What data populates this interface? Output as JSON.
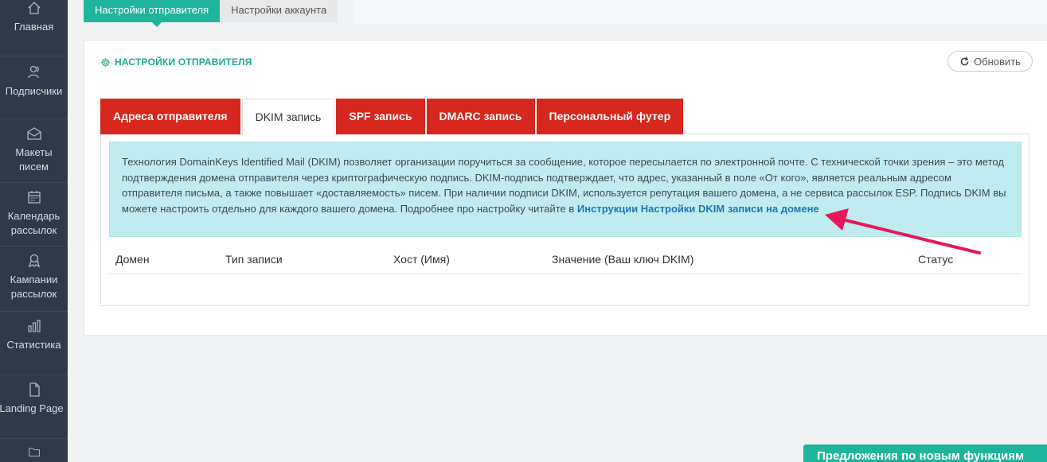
{
  "sidebar": {
    "items": [
      {
        "icon": "home-icon",
        "label": "Главная"
      },
      {
        "icon": "subscribers-icon",
        "label": "Подписчики"
      },
      {
        "icon": "envelope-icon",
        "label_1": "Макеты",
        "label_2": "писем"
      },
      {
        "icon": "calendar-icon",
        "label_1": "Календарь",
        "label_2": "рассылок"
      },
      {
        "icon": "award-icon",
        "label_1": "Кампании",
        "label_2": "рассылок"
      },
      {
        "icon": "stats-icon",
        "label": "Статистика"
      },
      {
        "icon": "file-icon",
        "label": "Landing Page"
      },
      {
        "icon": "folder-icon",
        "label": ""
      }
    ]
  },
  "top_tabs": [
    {
      "label": "Настройки отправителя",
      "active": true
    },
    {
      "label": "Настройки аккаунта",
      "active": false
    }
  ],
  "panel": {
    "title": "НАСТРОЙКИ ОТПРАВИТЕЛЯ",
    "refresh_label": "Обновить"
  },
  "sub_tabs": [
    {
      "label": "Адреса отправителя",
      "active": false
    },
    {
      "label": "DKIM запись",
      "active": true
    },
    {
      "label": "SPF запись",
      "active": false
    },
    {
      "label": "DMARC запись",
      "active": false
    },
    {
      "label": "Персональный футер",
      "active": false
    }
  ],
  "info": {
    "text": "Технология DomainKeys Identified Mail (DKIM) позволяет организации поручиться за сообщение, которое пересылается по электронной почте. С технической точки зрения – это метод подтверждения домена отправителя через криптографическую подпись. DKIM-подпись подтверждает, что адрес, указанный в поле «От кого», является реальным адресом отправителя письма, а также повышает «доставляемость» писем. При наличии подписи DKIM, используется репутация вашего домена, а не сервиса рассылок ESP. Подпись DKIM вы можете настроить отдельно для каждого вашего домена. Подробнее про настройку читайте в ",
    "link": "Инструкции Настройки DKIM записи на домене"
  },
  "table": {
    "columns": [
      "Домен",
      "Тип записи",
      "Хост (Имя)",
      "Значение (Ваш ключ DKIM)",
      "Статус"
    ]
  },
  "suggest_button": "Предложения по новым функциям",
  "colors": {
    "sidebar_bg": "#2f3a46",
    "accent_green": "#1fb59a",
    "tab_red": "#d6261e",
    "info_bg": "#c0ecf0",
    "link_blue": "#1f76b5",
    "arrow_pink": "#e8175d"
  }
}
